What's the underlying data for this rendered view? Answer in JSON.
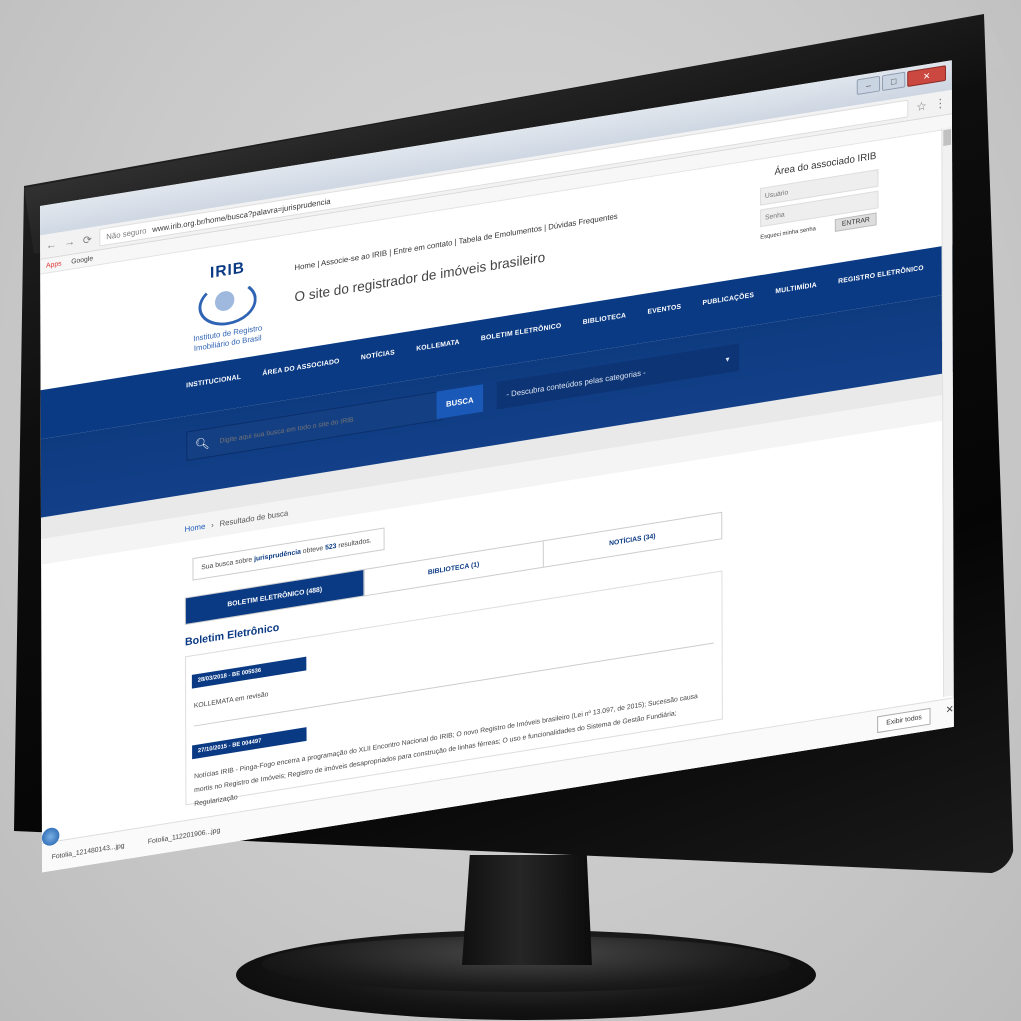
{
  "browser": {
    "url_prefix": "Não seguro",
    "url": "www.irib.org.br/home/busca?palavra=jurisprudencia",
    "bookmarks": [
      "Apps",
      "Google"
    ],
    "win_controls": [
      "–",
      "□",
      "✕"
    ],
    "star": "☆",
    "menu": "⋮"
  },
  "header": {
    "logo_text": "IRIB",
    "logo_caption": "Instituto de Registro Imobiliário do Brasil",
    "top_links": "Home | Associe-se ao IRIB | Entre em contato | Tabela de Emolumentos | Dúvidas Frequentes",
    "tagline": "O site do registrador de imóveis brasileiro"
  },
  "associado": {
    "title": "Área do associado IRIB",
    "user_placeholder": "Usuário",
    "pass_placeholder": "Senha",
    "forgot": "Esqueci minha senha",
    "enter": "ENTRAR"
  },
  "nav": {
    "items": [
      "INSTITUCIONAL",
      "ÁREA DO ASSOCIADO",
      "NOTÍCIAS",
      "KOLLEMATA",
      "BOLETIM ELETRÔNICO",
      "BIBLIOTECA",
      "EVENTOS",
      "PUBLICAÇÕES",
      "MULTIMÍDIA",
      "REGISTRO ELETRÔNICO"
    ]
  },
  "search": {
    "placeholder": "Digite aqui sua busca em todo o site do IRIB",
    "button": "BUSCA",
    "category_select": "- Descubra conteúdos pelas categorias -"
  },
  "breadcrumb": {
    "home": "Home",
    "separator": "›",
    "current": "Resultado de busca"
  },
  "result_summary": {
    "prefix": "Sua busca sobre",
    "term": "jurisprudência",
    "middle": "obteve",
    "count": "523",
    "suffix": "resultados."
  },
  "tabs": [
    {
      "label": "BOLETIM ELETRÔNICO (488)",
      "active": true
    },
    {
      "label": "BIBLIOTECA (1)",
      "active": false
    },
    {
      "label": "NOTÍCIAS (34)",
      "active": false
    }
  ],
  "section_title": "Boletim Eletrônico",
  "results": [
    {
      "badge": "28/03/2018 - BE 005536",
      "text": "KOLLEMATA em revisão"
    },
    {
      "badge": "27/10/2015 - BE 004497",
      "text": "Notícias IRIB - Pinga-Fogo encerra a programação do XLII Encontro Nacional do IRIB; O novo Registro de Imóveis brasileiro (Lei nº 13.097, de 2015); Sucessão causa mortis no Registro de Imóveis; Registro de imóveis desapropriados para construção de linhas férreas; O uso e funcionalidades do Sistema de Gestão Fundiária; Regularização"
    }
  ],
  "downloads": {
    "items": [
      "Fotolia_121480143...jpg",
      "Fotolia_112201906...jpg"
    ],
    "show_all": "Exibir todos",
    "close": "✕"
  }
}
